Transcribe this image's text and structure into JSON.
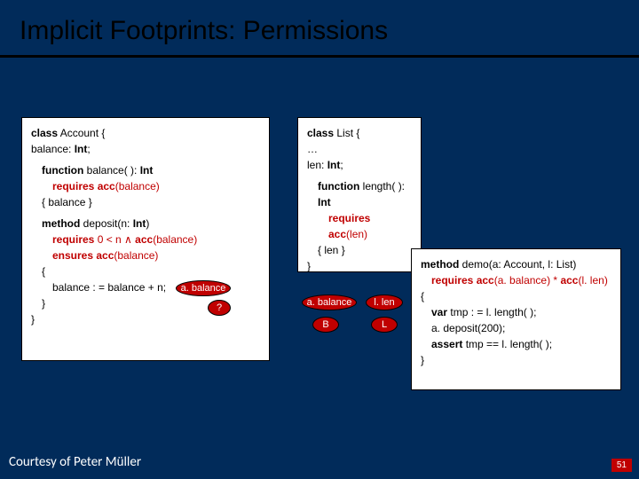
{
  "title": "Implicit Footprints: Permissions",
  "account": {
    "l1": "class",
    "l1b": " Account {",
    "l2": " balance: ",
    "l2b": "Int",
    "l2c": ";",
    "fn1a": "function",
    "fn1b": " balance( ): ",
    "fn1c": "Int",
    "req1a": "requires",
    "req1b": " acc",
    "req1c": "(balance)",
    "body1": "{ balance }",
    "m1a": "method",
    "m1b": " deposit(n: ",
    "m1c": "Int",
    "m1d": ")",
    "req2a": "requires",
    "req2b": " 0 < n ∧ ",
    "req2c": "acc",
    "req2d": "(balance)",
    "ens1a": "ensures",
    "ens1b": " acc",
    "ens1c": "(balance)",
    "brace1": "{",
    "assign": "balance : = balance + n;",
    "brace2": "}",
    "brace3": "}"
  },
  "list": {
    "l1": "class",
    "l1b": " List {",
    "dots": "…",
    "len1": " len: ",
    "len1b": "Int",
    "len1c": ";",
    "fn1a": "function",
    "fn1b": " length( ): ",
    "fn1c": "Int",
    "req1a": "requires",
    "req1b": " acc",
    "req1c": "(len)",
    "body1": "{ len }",
    "brace": "}"
  },
  "demo": {
    "m1a": "method",
    "m1b": " demo(a: Account, l: List)",
    "req1a": "requires",
    "req1b": " acc",
    "req1c": "(a. balance)",
    "req1d": " * ",
    "req1e": "acc",
    "req1f": "(l. len)",
    "brace1": "{",
    "s1a": "var",
    "s1b": " tmp : = l. length( );",
    "s2": "a. deposit(200);",
    "s3a": "assert",
    "s3b": " tmp == l. length( );",
    "brace2": "}"
  },
  "pills": {
    "abal": "a. balance",
    "q": "?",
    "ab2": "a. balance",
    "llen": "l. len",
    "b": "B",
    "l": "L"
  },
  "footer": {
    "left": "Courtesy of Peter Müller",
    "right": "51"
  }
}
